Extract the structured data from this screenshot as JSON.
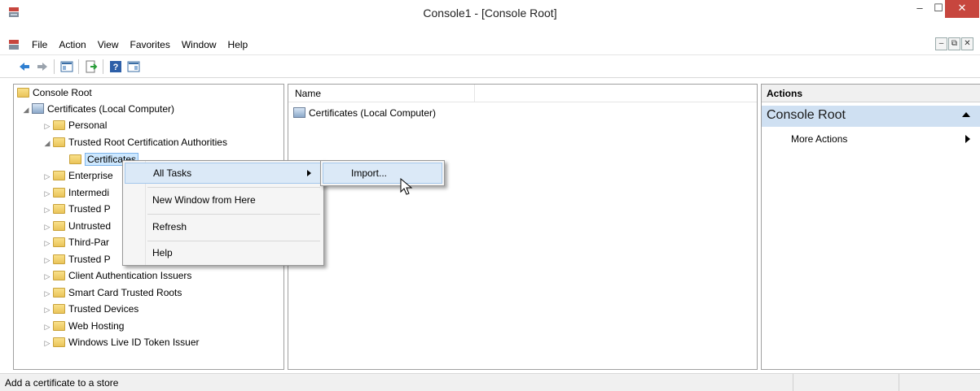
{
  "window": {
    "title": "Console1 - [Console Root]",
    "controls": {
      "minimize": "–",
      "maximize": "☐",
      "close": "✕"
    }
  },
  "menubar": {
    "items": [
      "File",
      "Action",
      "View",
      "Favorites",
      "Window",
      "Help"
    ],
    "mdi": {
      "minimize": "–",
      "restore": "⧉",
      "close": "✕"
    }
  },
  "toolbar": {
    "buttons": [
      "back-icon",
      "forward-icon",
      "show-hide-tree-icon",
      "export-list-icon",
      "help-icon",
      "show-hide-action-pane-icon"
    ]
  },
  "tree": {
    "root": "Console Root",
    "computer": "Certificates (Local Computer)",
    "items": [
      {
        "label": "Personal",
        "expander": "▷"
      },
      {
        "label": "Trusted Root Certification Authorities",
        "expander": "◢"
      },
      {
        "label": "Certificates",
        "selected": true
      },
      {
        "label": "Enterprise",
        "expander": "▷"
      },
      {
        "label": "Intermedi",
        "expander": "▷"
      },
      {
        "label": "Trusted P",
        "expander": "▷"
      },
      {
        "label": "Untrusted",
        "expander": "▷"
      },
      {
        "label": "Third-Par",
        "expander": "▷"
      },
      {
        "label": "Trusted P",
        "expander": "▷"
      },
      {
        "label": "Client Authentication Issuers",
        "expander": "▷"
      },
      {
        "label": "Smart Card Trusted Roots",
        "expander": "▷"
      },
      {
        "label": "Trusted Devices",
        "expander": "▷"
      },
      {
        "label": "Web Hosting",
        "expander": "▷"
      },
      {
        "label": "Windows Live ID Token Issuer",
        "expander": "▷"
      }
    ],
    "root_expander": "◢"
  },
  "list": {
    "column_name": "Name",
    "items": [
      "Certificates (Local Computer)"
    ]
  },
  "actions": {
    "header": "Actions",
    "section": "Console Root",
    "items": [
      "More Actions"
    ]
  },
  "context_menu": {
    "items": [
      "All Tasks",
      "New Window from Here",
      "Refresh",
      "Help"
    ]
  },
  "submenu": {
    "items": [
      "Import..."
    ]
  },
  "statusbar": {
    "text": "Add a certificate to a store"
  }
}
